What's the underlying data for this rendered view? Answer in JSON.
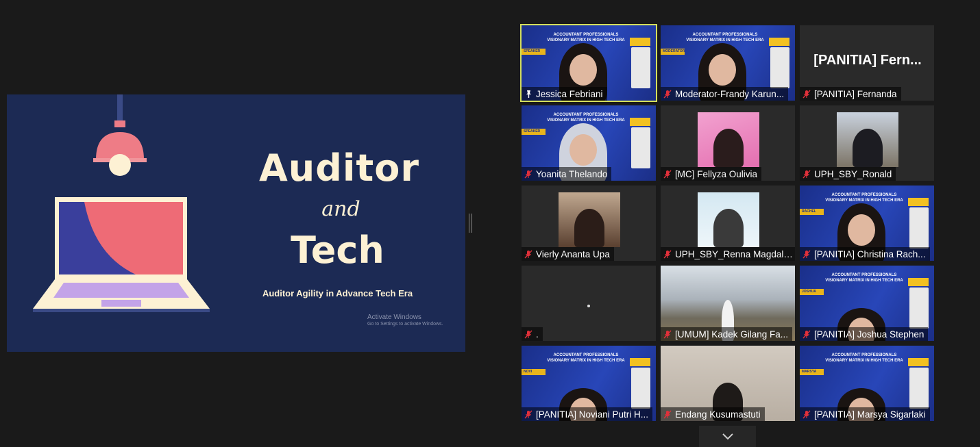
{
  "slide": {
    "title_line1": "Auditor",
    "title_line2": "and",
    "title_line3": "Tech",
    "subtitle": "Auditor Agility in Advance Tech Era",
    "watermark_line1": "Activate Windows",
    "watermark_line2": "Go to Settings to activate Windows."
  },
  "poster": {
    "title": "ACCOUNTANT PROFESSIONALS VISIONARY MATRIX IN HIGH TECH ERA"
  },
  "participants": [
    {
      "name": "Jessica Febriani",
      "badge": "SPEAKER",
      "mic": "pinned"
    },
    {
      "name": "Moderator-Frandy Karun...",
      "badge": "MODERATOR",
      "mic": "muted"
    },
    {
      "name": "[PANITIA] Fernanda",
      "big_label": "[PANITIA]  Fern...",
      "mic": "muted"
    },
    {
      "name": "Yoanita Thelando",
      "badge": "SPEAKER",
      "mic": "muted"
    },
    {
      "name": "[MC] Fellyza Oulivia",
      "mic": "muted"
    },
    {
      "name": "UPH_SBY_Ronald",
      "mic": "muted"
    },
    {
      "name": "Vierly Ananta Upa",
      "mic": "muted"
    },
    {
      "name": "UPH_SBY_Renna Magdale...",
      "mic": "muted"
    },
    {
      "name": "[PANITIA] Christina Rach...",
      "badge": "RACHEL",
      "mic": "muted"
    },
    {
      "name": ".",
      "mic": "muted"
    },
    {
      "name": "[UMUM] Kadek Gilang Fa...",
      "mic": "muted"
    },
    {
      "name": "[PANITIA] Joshua Stephen",
      "badge": "JOSHUA",
      "mic": "muted"
    },
    {
      "name": "[PANITIA] Noviani Putri H...",
      "badge": "NOVI",
      "mic": "muted"
    },
    {
      "name": "Endang Kusumastuti",
      "mic": "muted"
    },
    {
      "name": "[PANITIA] Marsya Sigarlaki",
      "badge": "MARSYA",
      "mic": "muted"
    }
  ],
  "icons": {
    "scroll_down": "chevron-down-icon",
    "muted": "mic-muted-icon",
    "pinned": "pin-icon"
  },
  "colors": {
    "active_speaker_border": "#d5df5a",
    "slide_background": "#1c2a54",
    "muted_mic": "#e0303a"
  }
}
